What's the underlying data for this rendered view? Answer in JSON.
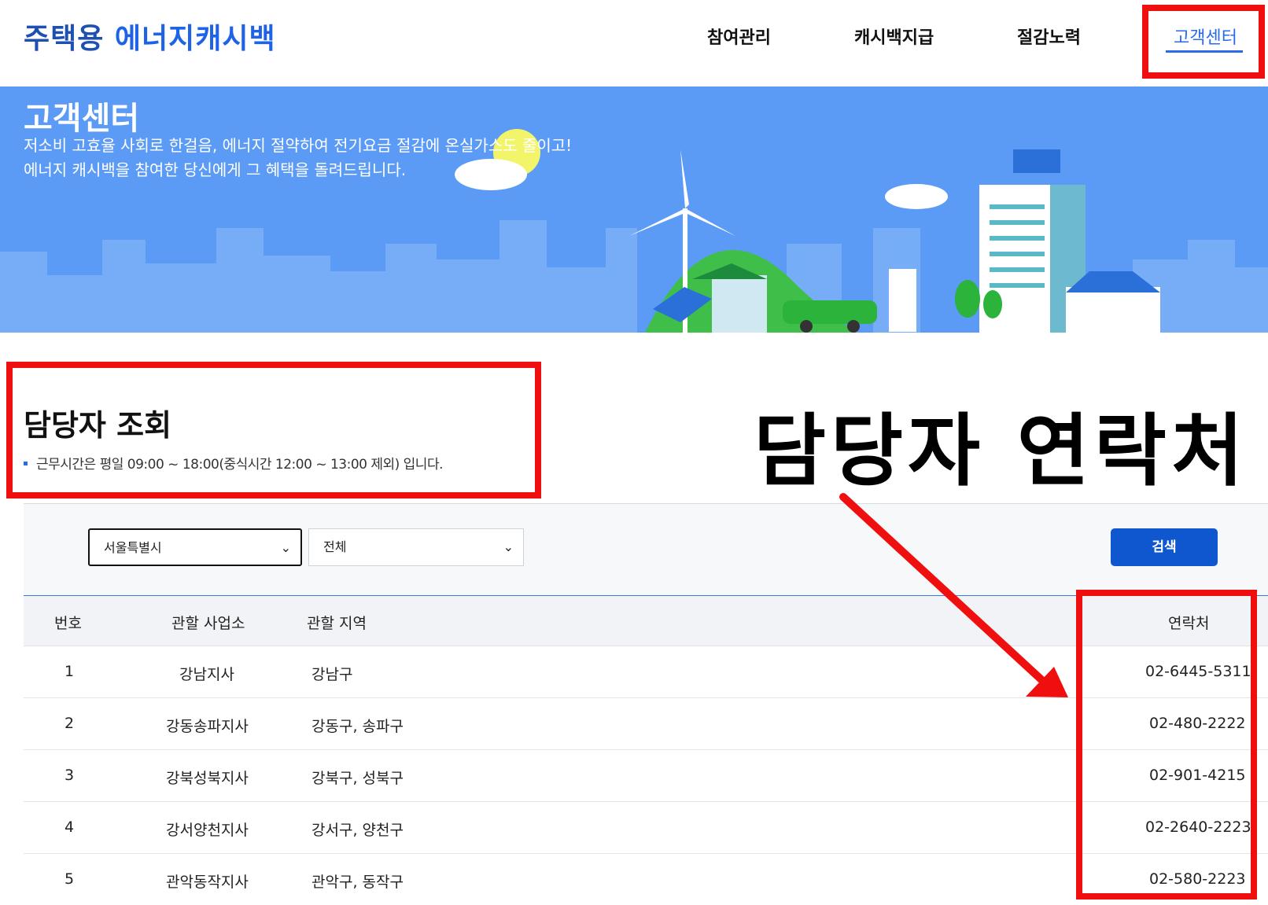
{
  "header": {
    "logo_part1": "주택용",
    "logo_part2": "에너지캐시백",
    "nav": [
      "참여관리",
      "캐시백지급",
      "절감노력",
      "고객센터"
    ]
  },
  "hero": {
    "title": "고객센터",
    "desc_line1": "저소비 고효율 사회로 한걸음, 에너지 절약하여 전기요금 절감에 온실가스도 줄이고!",
    "desc_line2": "에너지 캐시백을 참여한 당신에게 그 혜택을 돌려드립니다."
  },
  "section": {
    "title": "담당자 조회",
    "notice": "근무시간은 평일 09:00 ~ 18:00(중식시간 12:00 ~ 13:00 제외) 입니다."
  },
  "annotation": "담당자 연락처",
  "search": {
    "region": "서울특별시",
    "district": "전체",
    "button": "검색"
  },
  "table": {
    "headers": [
      "번호",
      "관할 사업소",
      "관할 지역",
      "연락처"
    ],
    "rows": [
      [
        "1",
        "강남지사",
        "강남구",
        "02-6445-5311"
      ],
      [
        "2",
        "강동송파지사",
        "강동구, 송파구",
        "02-480-2222"
      ],
      [
        "3",
        "강북성북지사",
        "강북구, 성북구",
        "02-901-4215"
      ],
      [
        "4",
        "강서양천지사",
        "강서구, 양천구",
        "02-2640-2223"
      ],
      [
        "5",
        "관악동작지사",
        "관악구, 동작구",
        "02-580-2223"
      ]
    ]
  },
  "colors": {
    "brand_blue": "#1f5bd6",
    "hero_bg": "#5b9bf5",
    "button_blue": "#0f57cf",
    "annotation_red": "#f00f0f"
  }
}
